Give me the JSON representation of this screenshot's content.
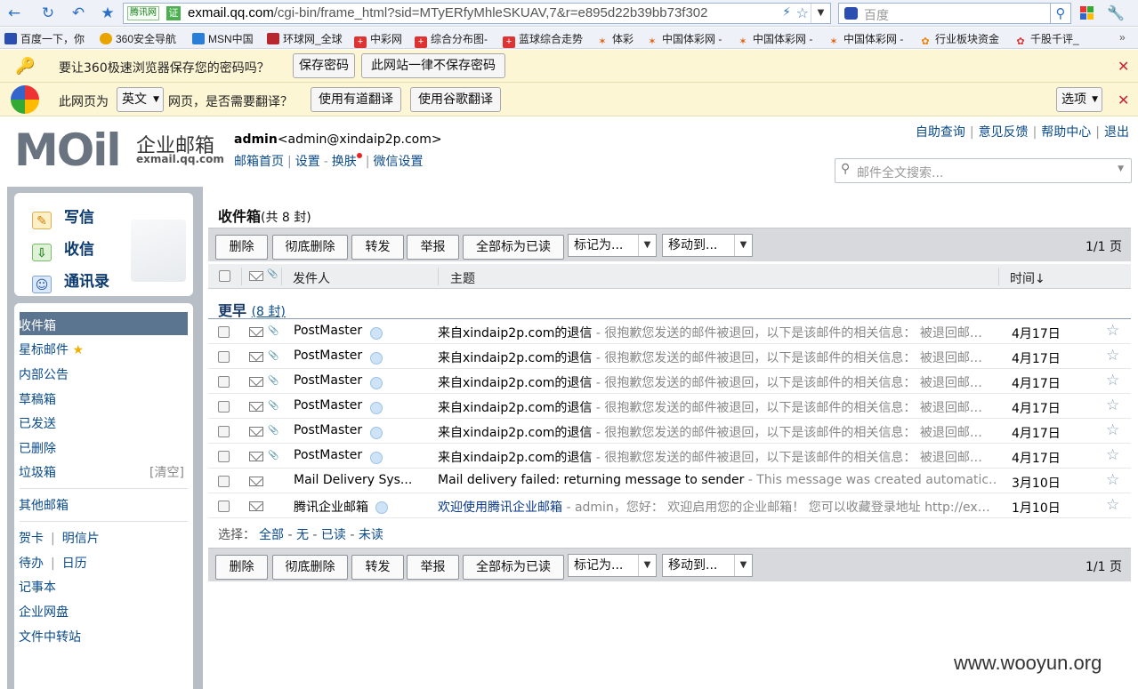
{
  "browser": {
    "url_tag": "腾讯网",
    "url_cert": "证",
    "url_host": "exmail.qq.com",
    "url_path": "/cgi-bin/frame_html?sid=MTyERfyMhleSKUAV,7&r=e895d22b39bb73f302",
    "search_placeholder": "百度",
    "bookmarks": [
      "百度一下，你",
      "360安全导航",
      "MSN中国",
      "环球网_全球",
      "中彩网",
      "综合分布图-",
      "蓝球综合走势",
      "体彩",
      "中国体彩网 -",
      "中国体彩网 -",
      "中国体彩网 -",
      "行业板块资金",
      "千股千评_"
    ],
    "bookmark_colors": [
      "#2a4fb0",
      "#e8a400",
      "#2a7ed6",
      "#b8262e",
      "#d33",
      "#d33",
      "#d33",
      "#e06010",
      "#e06010",
      "#e06010",
      "#e06010",
      "#f08000",
      "#d33"
    ]
  },
  "password_bar": {
    "text": "要让360极速浏览器保存您的密码吗？",
    "save": "保存密码",
    "never": "此网站一律不保存密码"
  },
  "translate_bar": {
    "prefix": "此网页为",
    "lang": "英文",
    "suffix": "网页，是否需要翻译？",
    "youdao": "使用有道翻译",
    "google": "使用谷歌翻译",
    "options": "选项"
  },
  "header": {
    "logo_text": "MOil",
    "logo_cn": "企业邮箱",
    "logo_domain": "exmail.qq.com",
    "user_name": "admin",
    "user_email": "<admin@xindaip2p.com>",
    "links": [
      "邮箱首页",
      "设置",
      "换肤",
      "微信设置"
    ],
    "top_links": [
      "自助查询",
      "意见反馈",
      "帮助中心",
      "退出"
    ],
    "search_placeholder": "邮件全文搜索..."
  },
  "compose": {
    "write": "写信",
    "receive": "收信",
    "contacts": "通讯录"
  },
  "folders": {
    "inbox": "收件箱",
    "starred": "星标邮件",
    "notice": "内部公告",
    "drafts": "草稿箱",
    "sent": "已发送",
    "deleted": "已删除",
    "spam": "垃圾箱",
    "spam_clear": "[清空]",
    "other": "其他邮箱",
    "card": "贺卡",
    "postcard": "明信片",
    "todo": "待办",
    "calendar": "日历",
    "notes": "记事本",
    "disk": "企业网盘",
    "transfer": "文件中转站"
  },
  "main": {
    "title": "收件箱",
    "count": "(共 8 封)",
    "toolbar": {
      "delete": "删除",
      "perm_delete": "彻底删除",
      "forward": "转发",
      "report": "举报",
      "mark_all_read": "全部标为已读",
      "mark_as": "标记为...",
      "move_to": "移动到...",
      "page": "1/1 页"
    },
    "columns": {
      "sender": "发件人",
      "subject": "主题",
      "time": "时间↓"
    },
    "group": "更早",
    "group_count": "(8 封)",
    "emails": [
      {
        "sender": "PostMaster",
        "subject": "来自xindaip2p.com的退信",
        "preview": " - 很抱歉您发送的邮件被退回，以下是该邮件的相关信息：   被退回邮…",
        "date": "4月17日"
      },
      {
        "sender": "PostMaster",
        "subject": "来自xindaip2p.com的退信",
        "preview": " - 很抱歉您发送的邮件被退回，以下是该邮件的相关信息：   被退回邮…",
        "date": "4月17日"
      },
      {
        "sender": "PostMaster",
        "subject": "来自xindaip2p.com的退信",
        "preview": " - 很抱歉您发送的邮件被退回，以下是该邮件的相关信息：   被退回邮…",
        "date": "4月17日"
      },
      {
        "sender": "PostMaster",
        "subject": "来自xindaip2p.com的退信",
        "preview": " - 很抱歉您发送的邮件被退回，以下是该邮件的相关信息：   被退回邮…",
        "date": "4月17日"
      },
      {
        "sender": "PostMaster",
        "subject": "来自xindaip2p.com的退信",
        "preview": " - 很抱歉您发送的邮件被退回，以下是该邮件的相关信息：   被退回邮…",
        "date": "4月17日"
      },
      {
        "sender": "PostMaster",
        "subject": "来自xindaip2p.com的退信",
        "preview": " - 很抱歉您发送的邮件被退回，以下是该邮件的相关信息：   被退回邮…",
        "date": "4月17日"
      },
      {
        "sender": "Mail Delivery Sys...",
        "subject": "Mail delivery failed: returning message to sender",
        "preview": " - This message was created automatic…",
        "date": "3月10日"
      },
      {
        "sender": "腾讯企业邮箱",
        "subject": "欢迎使用腾讯企业邮箱",
        "preview": " - admin，您好： 欢迎启用您的企业邮箱！ 您可以收藏登录地址 http://ex…",
        "date": "1月10日"
      }
    ],
    "select_label": "选择：",
    "select_all": "全部",
    "select_none": "无",
    "select_read": "已读",
    "select_unread": "未读"
  },
  "watermark": "www.wooyun.org"
}
